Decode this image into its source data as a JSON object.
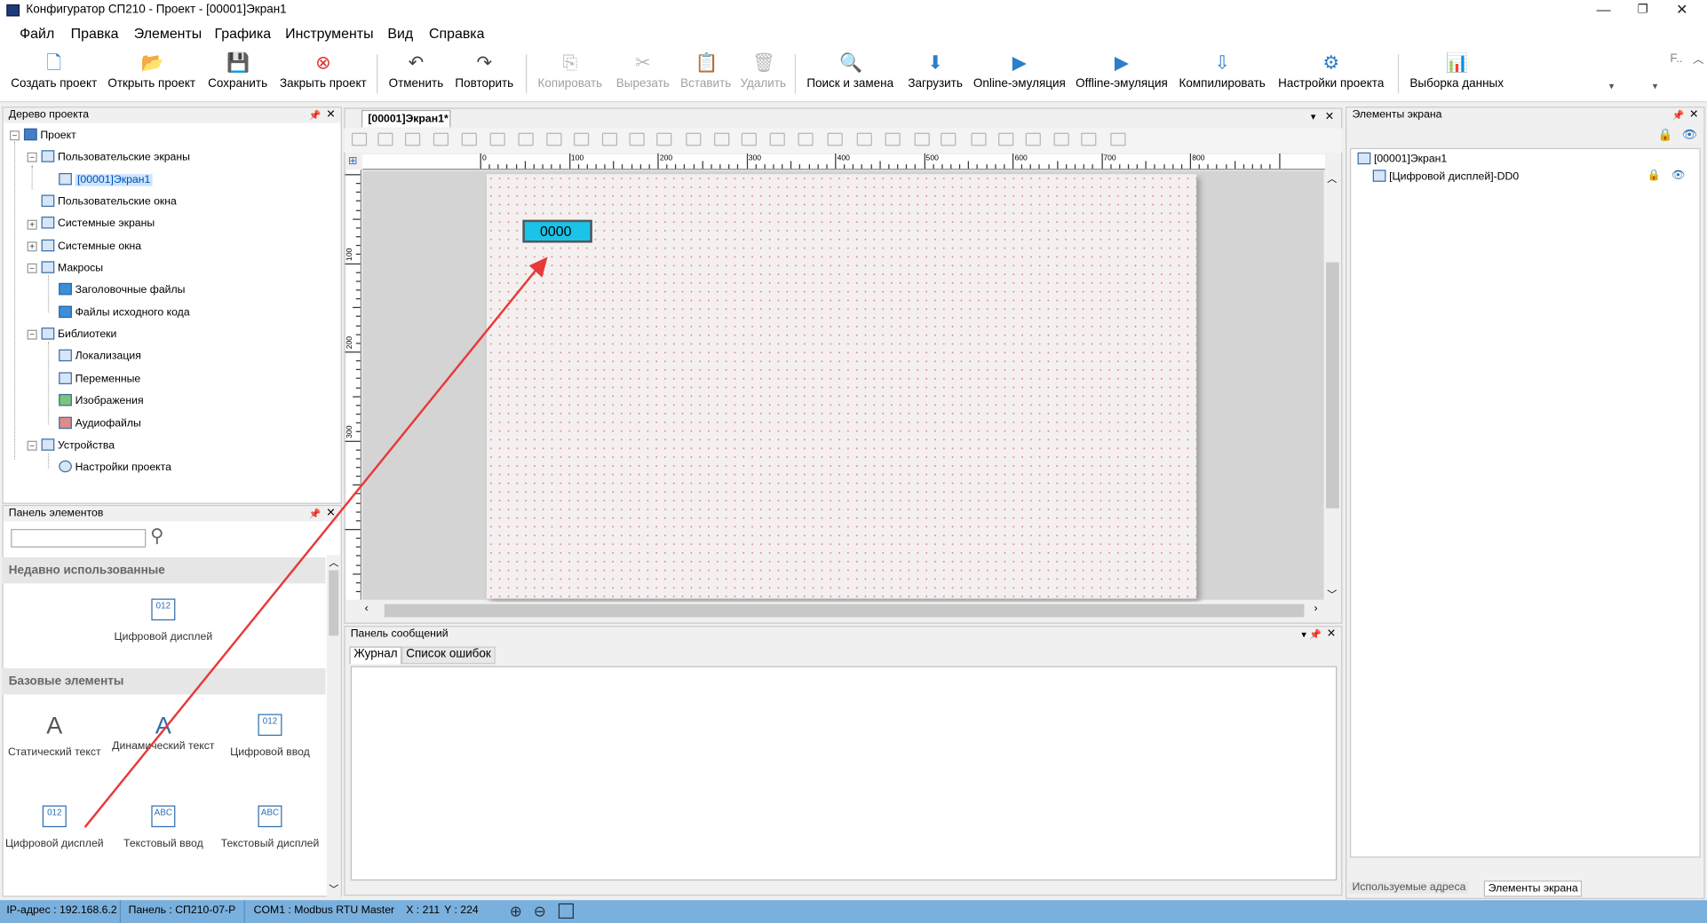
{
  "window": {
    "title": "Конфигуратор СП210 - Проект - [00001]Экран1",
    "buttons": [
      "—",
      "❐",
      "✕"
    ]
  },
  "menu": [
    "Файл",
    "Правка",
    "Элементы",
    "Графика",
    "Инструменты",
    "Вид",
    "Справка"
  ],
  "toolbar": {
    "items": [
      {
        "label": "Создать проект",
        "icon": "new-project-icon",
        "enabled": true
      },
      {
        "label": "Открыть проект",
        "icon": "open-project-icon",
        "enabled": true
      },
      {
        "label": "Сохранить",
        "icon": "save-icon",
        "enabled": true
      },
      {
        "label": "Закрыть проект",
        "icon": "close-project-icon",
        "enabled": true
      },
      {
        "label": "Отменить",
        "icon": "undo-icon",
        "enabled": true
      },
      {
        "label": "Повторить",
        "icon": "redo-icon",
        "enabled": true
      },
      {
        "label": "Копировать",
        "icon": "copy-icon",
        "enabled": false
      },
      {
        "label": "Вырезать",
        "icon": "cut-icon",
        "enabled": false
      },
      {
        "label": "Вставить",
        "icon": "paste-icon",
        "enabled": false
      },
      {
        "label": "Удалить",
        "icon": "delete-icon",
        "enabled": false
      },
      {
        "label": "Поиск и замена",
        "icon": "search-replace-icon",
        "enabled": true
      },
      {
        "label": "Загрузить",
        "icon": "download-icon",
        "enabled": true
      },
      {
        "label": "Online-эмуляция",
        "icon": "online-emulation-icon",
        "enabled": true
      },
      {
        "label": "Offline-эмуляция",
        "icon": "offline-emulation-icon",
        "enabled": true
      },
      {
        "label": "Компилировать",
        "icon": "compile-icon",
        "enabled": true
      },
      {
        "label": "Настройки проекта",
        "icon": "gear-icon",
        "enabled": true
      },
      {
        "label": "Выборка данных",
        "icon": "data-sample-icon",
        "enabled": true
      }
    ]
  },
  "project_tree": {
    "title": "Дерево проекта",
    "items": [
      {
        "label": "Проект"
      },
      {
        "label": "Пользовательские экраны"
      },
      {
        "label": "[00001]Экран1"
      },
      {
        "label": "Пользовательские окна"
      },
      {
        "label": "Системные экраны"
      },
      {
        "label": "Системные окна"
      },
      {
        "label": "Макросы"
      },
      {
        "label": "Заголовочные файлы"
      },
      {
        "label": "Файлы исходного кода"
      },
      {
        "label": "Библиотеки"
      },
      {
        "label": "Локализация"
      },
      {
        "label": "Переменные"
      },
      {
        "label": "Изображения"
      },
      {
        "label": "Аудиофайлы"
      },
      {
        "label": "Устройства"
      },
      {
        "label": "Настройки проекта"
      }
    ]
  },
  "palette": {
    "title": "Панель элементов",
    "search_placeholder": "",
    "recent_title": "Недавно использованные",
    "recent": [
      {
        "label": "Цифровой дисплей",
        "glyph": "012"
      }
    ],
    "basic_title": "Базовые элементы",
    "basic": [
      {
        "label": "Статический текст",
        "glyph": "A"
      },
      {
        "label": "Динамический текст",
        "glyph": "A"
      },
      {
        "label": "Цифровой ввод",
        "glyph": "012"
      },
      {
        "label": "Цифровой дисплей",
        "glyph": "012"
      },
      {
        "label": "Текстовый ввод",
        "glyph": "ABC"
      },
      {
        "label": "Текстовый дисплей",
        "glyph": "ABC"
      }
    ]
  },
  "document": {
    "tab": "[00001]Экран1*",
    "ruler_h": [
      "0",
      "100",
      "200",
      "300",
      "400",
      "500",
      "600",
      "700",
      "800"
    ],
    "ruler_v": [
      "100",
      "200",
      "300"
    ],
    "display_value": "0000"
  },
  "screen_elements": {
    "title": "Элементы экрана",
    "root": "[00001]Экран1",
    "child": "[Цифровой дисплей]-DD0",
    "tabs": [
      "Используемые адреса",
      "Элементы экрана"
    ]
  },
  "messages": {
    "title": "Панель сообщений",
    "tabs": [
      "Журнал",
      "Список ошибок"
    ]
  },
  "status": {
    "ip": "IP-адрес : 192.168.6.2",
    "panel": "Панель : СП210-07-Р",
    "com": "COM1 : Modbus RTU Master",
    "x": "X : 211",
    "y": "Y : 224"
  },
  "colors": {
    "accent": "#2d7ec9",
    "display_fill": "#1bc3e8",
    "status_bar": "#7ab0dd",
    "arrow": "#e8393a"
  }
}
